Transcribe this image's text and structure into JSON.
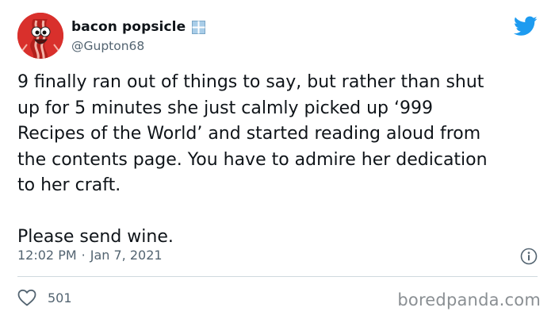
{
  "user": {
    "display_name": "bacon popsicle",
    "handle": "@Gupton68",
    "avatar_icon": "bacon-cartoon-avatar",
    "name_emoji": "window-emoji"
  },
  "tweet": {
    "text": "9 finally ran out of things to say, but rather than shut\nup for 5 minutes she just calmly picked up ‘999\nRecipes of the World’ and started reading aloud from\nthe contents page. You have to admire her dedication\nto her craft.\n\nPlease send wine.",
    "time": "12:02 PM",
    "separator": "·",
    "date": "Jan 7, 2021"
  },
  "stats": {
    "likes": "501"
  },
  "watermark": "boredpanda.com",
  "colors": {
    "twitter_blue": "#1d9bf0",
    "secondary_text": "#536471",
    "avatar_bg": "#d9302c"
  }
}
